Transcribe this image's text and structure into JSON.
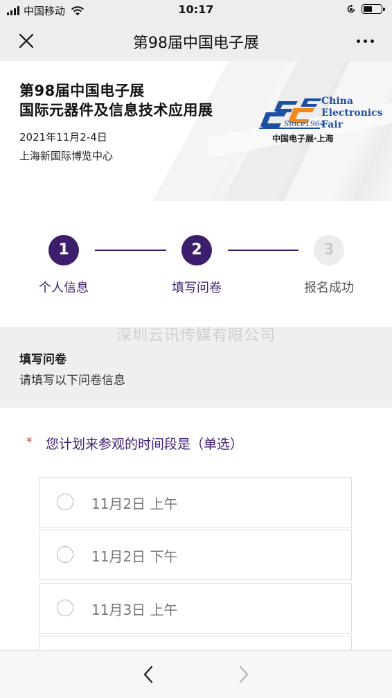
{
  "status_bar": {
    "carrier": "中国移动",
    "time": "10:17",
    "battery_level": 0.55
  },
  "nav": {
    "title": "第98届中国电子展",
    "close_icon": "close-icon",
    "more_icon": "more-dots-icon"
  },
  "banner": {
    "title_line1": "第98届中国电子展",
    "title_line2": "国际元器件及信息技术应用展",
    "date": "2021年11月2-4日",
    "venue": "上海新国际博览中心",
    "logo": {
      "en_line1": "China",
      "en_line2": "Electronics",
      "en_line3": "Fair",
      "since": "Since1964",
      "cn": "中国电子展·上海",
      "colors": {
        "blue": "#1d4fa3",
        "orange": "#f08a1c"
      }
    }
  },
  "steps": [
    {
      "number": "1",
      "label": "个人信息",
      "state": "done"
    },
    {
      "number": "2",
      "label": "填写问卷",
      "state": "current"
    },
    {
      "number": "3",
      "label": "报名成功",
      "state": "pending"
    }
  ],
  "watermark": "深圳云讯传媒有限公司",
  "section": {
    "title": "填写问卷",
    "subtitle": "请填写以下问卷信息"
  },
  "question": {
    "required_mark": "*",
    "text": "您计划来参观的时间段是（单选）",
    "options": [
      {
        "label": "11月2日 上午",
        "selected": false
      },
      {
        "label": "11月2日 下午",
        "selected": false
      },
      {
        "label": "11月3日 上午",
        "selected": false
      },
      {
        "label": "",
        "selected": false
      }
    ]
  },
  "toolbar": {
    "back_icon": "chevron-left-icon",
    "forward_icon": "chevron-right-icon",
    "forward_enabled": false
  },
  "colors": {
    "accent": "#3d1e6d",
    "required": "#e0433f",
    "inactive_step": "#ececec"
  }
}
